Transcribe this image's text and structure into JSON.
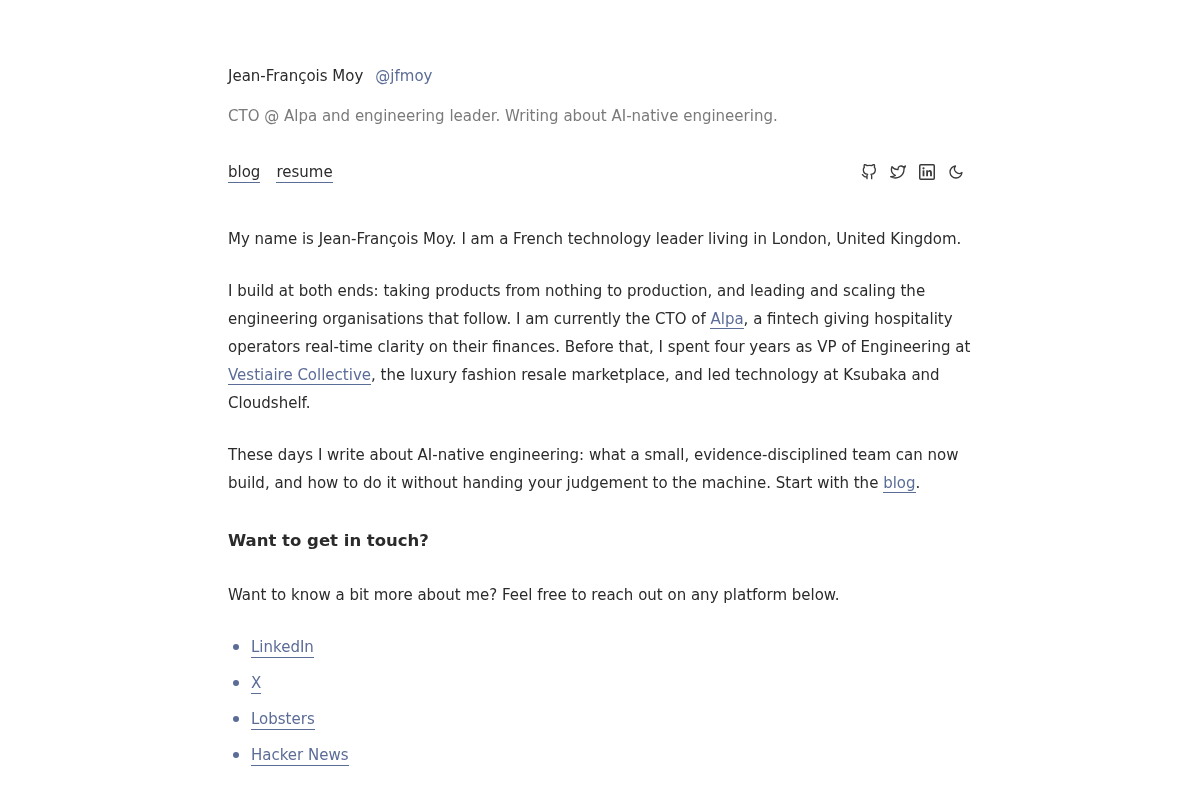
{
  "header": {
    "name": "Jean-François Moy",
    "handle": "@jfmoy",
    "tagline": "CTO @ Alpa and engineering leader. Writing about AI-native engineering."
  },
  "nav": {
    "links": [
      "blog",
      "resume"
    ]
  },
  "intro": [
    [
      {
        "kind": "text",
        "text": "My name is Jean-François Moy. I am a French technology leader living in London, United Kingdom."
      }
    ],
    [
      {
        "kind": "text",
        "text": "I build at both ends: taking products from nothing to production, and leading and scaling the engineering organisations that follow. I am currently the CTO of "
      },
      {
        "kind": "link",
        "text": "Alpa"
      },
      {
        "kind": "text",
        "text": ", a fintech giving hospitality operators real-time clarity on their finances. Before that, I spent four years as VP of Engineering at "
      },
      {
        "kind": "link",
        "text": "Vestiaire Collective"
      },
      {
        "kind": "text",
        "text": ", the luxury fashion resale marketplace, and led technology at Ksubaka and Cloudshelf."
      }
    ],
    [
      {
        "kind": "text",
        "text": "These days I write about AI-native engineering: what a small, evidence-disciplined team can now build, and how to do it without handing your judgement to the machine. Start with the "
      },
      {
        "kind": "link",
        "text": "blog"
      },
      {
        "kind": "text",
        "text": "."
      }
    ]
  ],
  "contact": {
    "heading": "Want to get in touch?",
    "text": "Want to know a bit more about me? Feel free to reach out on any platform below.",
    "links": [
      "LinkedIn",
      "X",
      "Lobsters",
      "Hacker News"
    ]
  }
}
